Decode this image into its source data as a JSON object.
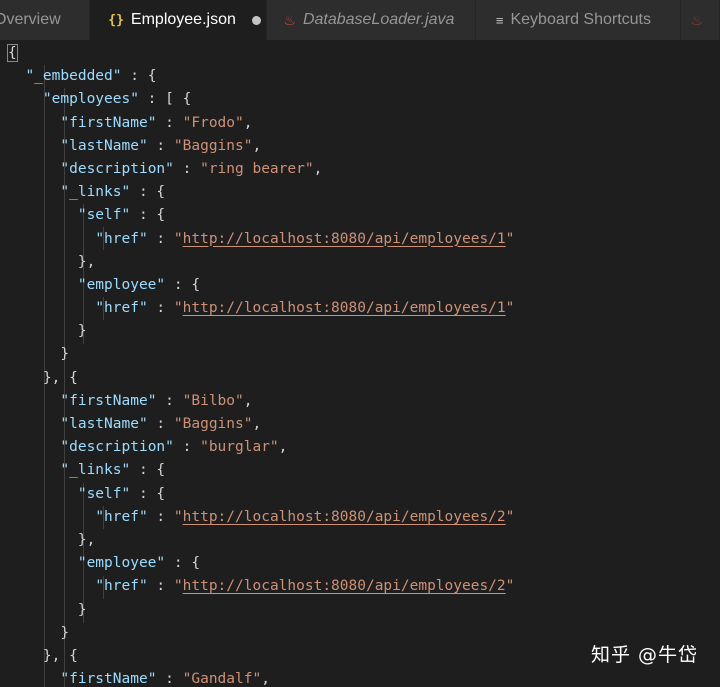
{
  "tabs": [
    {
      "label": "Overview",
      "icon": "",
      "active": false,
      "dirty": false,
      "italic": false
    },
    {
      "label": "Employee.json",
      "icon": "json-braces-icon",
      "active": true,
      "dirty": true,
      "italic": false
    },
    {
      "label": "DatabaseLoader.java",
      "icon": "java-icon",
      "active": false,
      "dirty": false,
      "italic": true
    },
    {
      "label": "Keyboard Shortcuts",
      "icon": "keyboard-shortcuts-icon",
      "active": false,
      "dirty": false,
      "italic": false
    }
  ],
  "editor": {
    "language": "json",
    "lines": [
      "{",
      "  \"_embedded\" : {",
      "    \"employees\" : [ {",
      "      \"firstName\" : \"Frodo\",",
      "      \"lastName\" : \"Baggins\",",
      "      \"description\" : \"ring bearer\",",
      "      \"_links\" : {",
      "        \"self\" : {",
      "          \"href\" : \"http://localhost:8080/api/employees/1\"",
      "        },",
      "        \"employee\" : {",
      "          \"href\" : \"http://localhost:8080/api/employees/1\"",
      "        }",
      "      }",
      "    }, {",
      "      \"firstName\" : \"Bilbo\",",
      "      \"lastName\" : \"Baggins\",",
      "      \"description\" : \"burglar\",",
      "      \"_links\" : {",
      "        \"self\" : {",
      "          \"href\" : \"http://localhost:8080/api/employees/2\"",
      "        },",
      "        \"employee\" : {",
      "          \"href\" : \"http://localhost:8080/api/employees/2\"",
      "        }",
      "      }",
      "    }, {",
      "      \"firstName\" : \"Gandalf\","
    ]
  },
  "watermark": "知乎 @牛岱",
  "colors": {
    "background": "#1e1e1e",
    "tabbar": "#252526",
    "tab_inactive": "#2d2d2d",
    "key": "#9cdcfe",
    "string": "#ce9178",
    "punctuation": "#d4d4d4",
    "json_icon": "#e8c34a",
    "java_icon": "#c6453a"
  }
}
